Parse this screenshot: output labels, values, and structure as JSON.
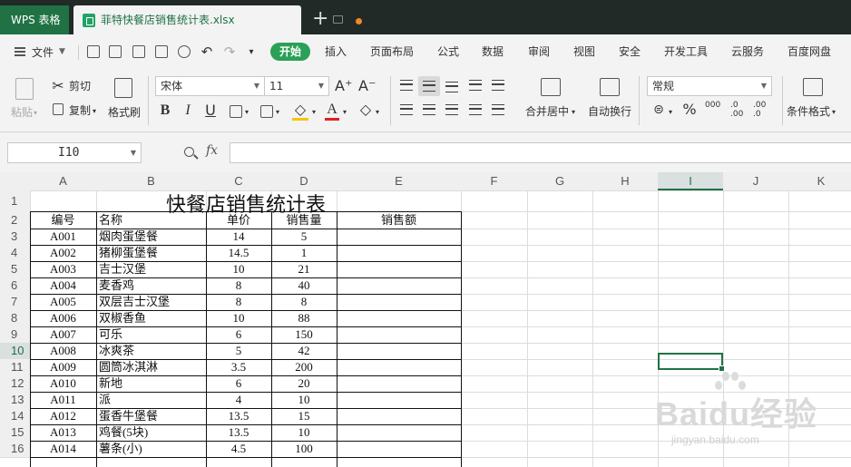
{
  "titlebar": {
    "app_name": "WPS 表格",
    "file_name": "菲特快餐店销售统计表.xlsx",
    "new_tab": "+"
  },
  "menubar": {
    "file_label": "文件",
    "active_tab": "开始",
    "tabs": [
      "插入",
      "页面布局",
      "公式",
      "数据",
      "审阅",
      "视图",
      "安全",
      "开发工具",
      "云服务",
      "百度网盘"
    ]
  },
  "ribbon": {
    "paste": "粘贴",
    "cut": "剪切",
    "copy": "复制",
    "format_painter": "格式刷",
    "font_name": "宋体",
    "font_size": "11",
    "grow": "A⁺",
    "shrink": "A⁻",
    "bold": "B",
    "italic": "I",
    "underline": "U",
    "merge_center": "合并居中",
    "wrap_text": "自动换行",
    "number_format": "常规",
    "percent": "%",
    "thousands": "000",
    "inc_decimal": ".0 .00",
    "dec_decimal": ".00 .0",
    "table_style": "条件格式"
  },
  "formula_bar": {
    "name_box": "I10",
    "fx": "fx",
    "formula": ""
  },
  "columns": [
    "A",
    "B",
    "C",
    "D",
    "E",
    "F",
    "G",
    "H",
    "I",
    "J",
    "K"
  ],
  "rows": [
    "1",
    "2",
    "3",
    "4",
    "5",
    "6",
    "7",
    "8",
    "9",
    "10",
    "11",
    "12",
    "13",
    "14",
    "15",
    "16"
  ],
  "selected_cell": {
    "column": "I",
    "row": "10"
  },
  "sheet": {
    "title": "快餐店销售统计表",
    "headers": [
      "编号",
      "名称",
      "单价",
      "销售量",
      "销售额"
    ],
    "records": [
      [
        "A001",
        "烟肉蛋堡餐",
        "14",
        "5"
      ],
      [
        "A002",
        "猪柳蛋堡餐",
        "14.5",
        "1"
      ],
      [
        "A003",
        "吉士汉堡",
        "10",
        "21"
      ],
      [
        "A004",
        "麦香鸡",
        "8",
        "40"
      ],
      [
        "A005",
        "双层吉士汉堡",
        "8",
        "8"
      ],
      [
        "A006",
        "双椒香鱼",
        "10",
        "88"
      ],
      [
        "A007",
        "可乐",
        "6",
        "150"
      ],
      [
        "A008",
        "冰爽茶",
        "5",
        "42"
      ],
      [
        "A009",
        "圆筒冰淇淋",
        "3.5",
        "200"
      ],
      [
        "A010",
        "新地",
        "6",
        "20"
      ],
      [
        "A011",
        "派",
        "4",
        "10"
      ],
      [
        "A012",
        "蛋香牛堡餐",
        "13.5",
        "15"
      ],
      [
        "A013",
        "鸡餐(5块)",
        "13.5",
        "10"
      ],
      [
        "A014",
        "薯条(小)",
        "4.5",
        "100"
      ]
    ]
  },
  "watermark": {
    "main": "Baidu经验",
    "sub": "jingyan.baidu.com"
  }
}
